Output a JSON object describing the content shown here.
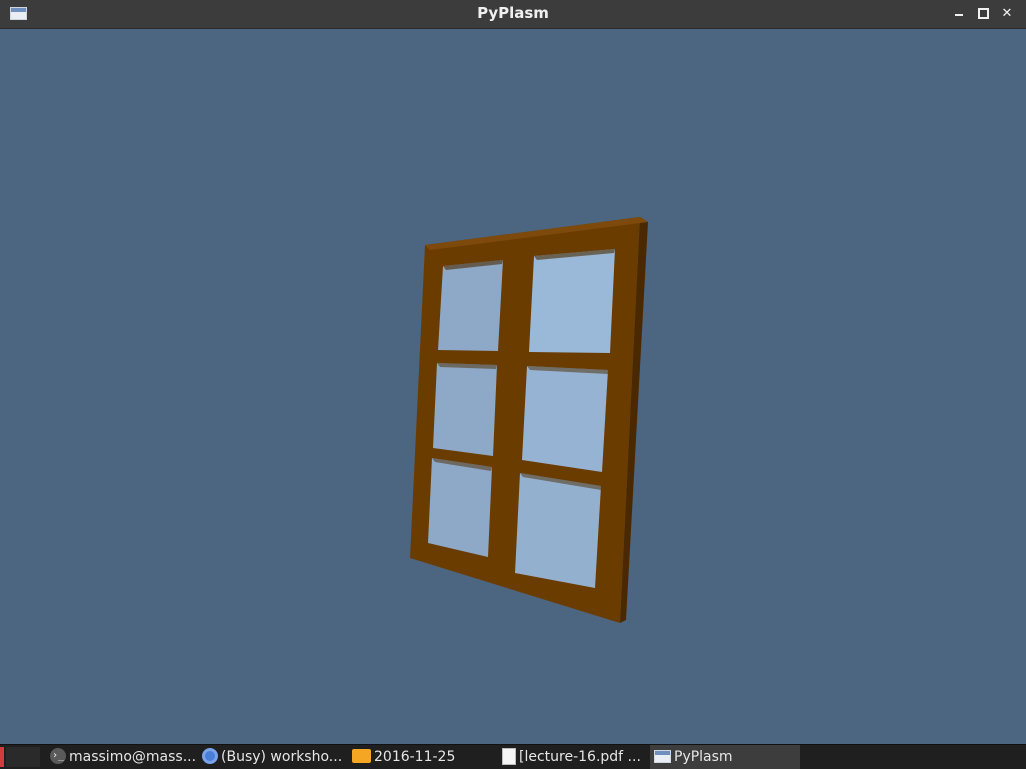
{
  "window": {
    "title": "PyPlasm",
    "icon": "window-app-icon",
    "controls": {
      "minimize_icon": "minimize-icon",
      "maximize_icon": "maximize-icon",
      "close_glyph": "✕"
    }
  },
  "viewport": {
    "background_color": "#4c6580",
    "model": {
      "frame_color": "#6b3c00",
      "glass_color": "#93b0cf"
    }
  },
  "taskbar": {
    "items": [
      {
        "label": "massimo@mass...",
        "icon": "terminal-icon"
      },
      {
        "label": "(Busy) worksho...",
        "icon": "chrome-icon"
      },
      {
        "label": "2016-11-25",
        "icon": "folder-icon"
      },
      {
        "label": "[lecture-16.pdf ...",
        "icon": "pdf-icon"
      },
      {
        "label": "PyPlasm",
        "icon": "window-app-icon"
      }
    ]
  }
}
